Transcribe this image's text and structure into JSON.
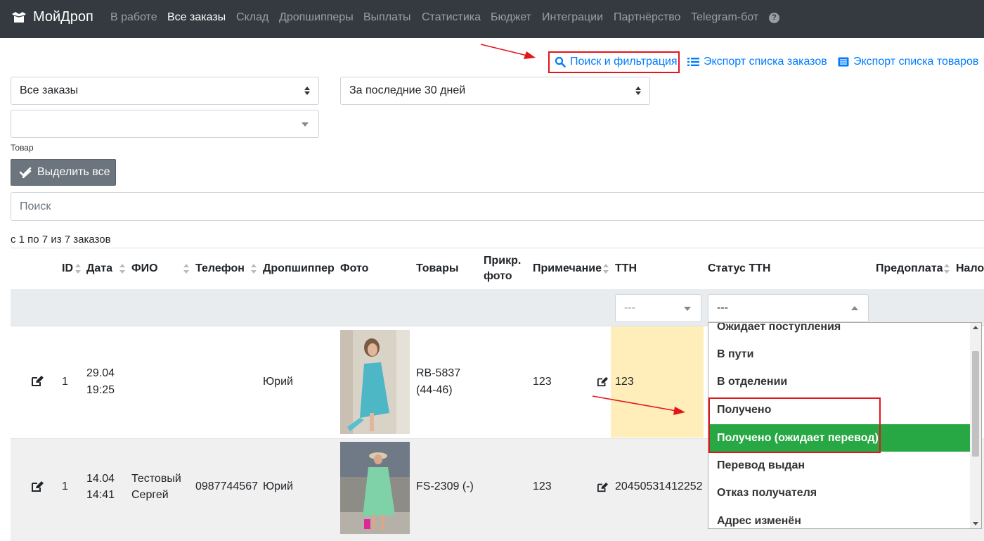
{
  "nav": {
    "brand": "МойДроп",
    "items": [
      "В работе",
      "Все заказы",
      "Склад",
      "Дропшипперы",
      "Выплаты",
      "Статистика",
      "Бюджет",
      "Интеграции",
      "Партнёрство",
      "Telegram-бот"
    ],
    "active_index": 1
  },
  "actions": {
    "search_filter": "Поиск и фильтрация",
    "export_orders": "Экспорт списка заказов",
    "export_goods": "Экспорт списка товаров"
  },
  "filters": {
    "orders_select": "Все заказы",
    "period_select": "За последние 30 дней",
    "product_select": "",
    "product_label": "Товар",
    "select_all": "Выделить все",
    "search_placeholder": "Поиск"
  },
  "count_text": "с 1 по 7 из 7 заказов",
  "table": {
    "headers": {
      "id": "ID",
      "date": "Дата",
      "fio": "ФИО",
      "phone": "Телефон",
      "dropshipper": "Дропшиппер",
      "photo": "Фото",
      "goods": "Товары",
      "attach_photo": "Прикр. фото",
      "note": "Примечание",
      "ttn": "ТТН",
      "ttn_status": "Статус ТТН",
      "prepay": "Предоплата",
      "cod": "Нало"
    },
    "ttn_filter": "---",
    "status_filter": "---",
    "rows": [
      {
        "id": "1",
        "date": "29.04",
        "time": "19:25",
        "fio1": "",
        "fio2": "",
        "phone": "",
        "dropshipper": "Юрий",
        "goods1": "RB-5837",
        "goods2": "(44-46)",
        "note": "123",
        "ttn": "123"
      },
      {
        "id": "1",
        "date": "14.04",
        "time": "14:41",
        "fio1": "Тестовый",
        "fio2": "Сергей",
        "phone": "0987744567",
        "dropshipper": "Юрий",
        "goods1": "FS-2309 (-)",
        "goods2": "",
        "note": "123",
        "ttn": "20450531412252"
      }
    ]
  },
  "status_options": [
    "Ожидает поступления",
    "В пути",
    "В отделении",
    "Получено",
    "Получено (ожидает перевод)",
    "Перевод выдан",
    "Отказ получателя",
    "Адрес изменён"
  ],
  "status_selected_index": 4,
  "colors": {
    "navbar": "#343a40",
    "link": "#007bff",
    "selected": "#28a745",
    "highlight": "#ffeeba",
    "annotation": "#e3151a"
  }
}
